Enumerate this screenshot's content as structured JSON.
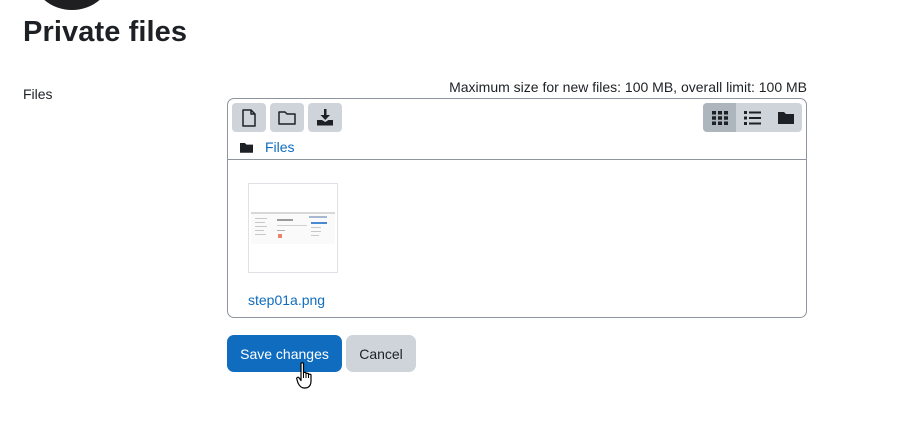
{
  "page": {
    "title": "Private files"
  },
  "form": {
    "files_label": "Files",
    "limits_text": "Maximum size for new files: 100 MB, overall limit: 100 MB"
  },
  "filemanager": {
    "toolbar": [
      {
        "name": "add-file-button",
        "icon": "file-icon"
      },
      {
        "name": "create-folder-button",
        "icon": "folder-icon"
      },
      {
        "name": "download-button",
        "icon": "download-icon"
      }
    ],
    "views": [
      {
        "name": "icons-view-button",
        "icon": "grid-icon",
        "active": true
      },
      {
        "name": "list-view-button",
        "icon": "list-icon",
        "active": false
      },
      {
        "name": "tree-view-button",
        "icon": "folder-icon",
        "active": false
      }
    ],
    "path_label": "Files",
    "files": [
      {
        "name": "step01a.png"
      }
    ]
  },
  "buttons": {
    "save": "Save changes",
    "cancel": "Cancel"
  },
  "colors": {
    "primary": "#0f6cbf",
    "secondary": "#ced4da",
    "active_view": "#adb5bd"
  }
}
